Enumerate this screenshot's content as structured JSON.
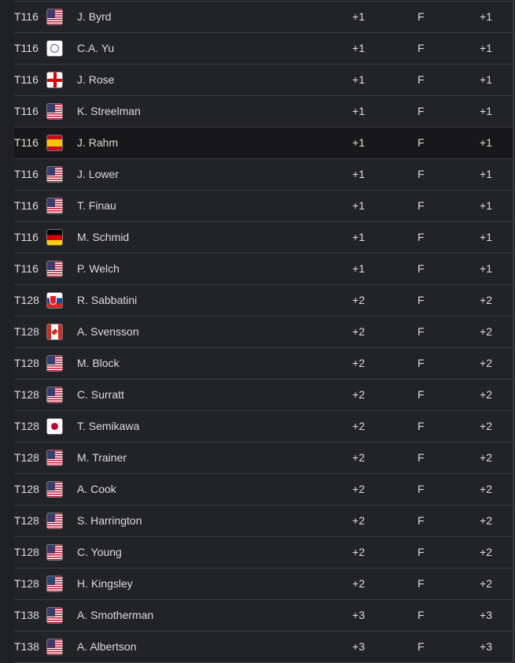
{
  "leaderboard": {
    "highlighted_row": 4,
    "rows": [
      {
        "pos": "T116",
        "flag": "usa",
        "name": "J. Byrd",
        "today": "+1",
        "thru": "F",
        "total": "+1"
      },
      {
        "pos": "T116",
        "flag": "tpe",
        "name": "C.A. Yu",
        "today": "+1",
        "thru": "F",
        "total": "+1"
      },
      {
        "pos": "T116",
        "flag": "eng",
        "name": "J. Rose",
        "today": "+1",
        "thru": "F",
        "total": "+1"
      },
      {
        "pos": "T116",
        "flag": "usa",
        "name": "K. Streelman",
        "today": "+1",
        "thru": "F",
        "total": "+1"
      },
      {
        "pos": "T116",
        "flag": "esp",
        "name": "J. Rahm",
        "today": "+1",
        "thru": "F",
        "total": "+1"
      },
      {
        "pos": "T116",
        "flag": "usa",
        "name": "J. Lower",
        "today": "+1",
        "thru": "F",
        "total": "+1"
      },
      {
        "pos": "T116",
        "flag": "usa",
        "name": "T. Finau",
        "today": "+1",
        "thru": "F",
        "total": "+1"
      },
      {
        "pos": "T116",
        "flag": "ger",
        "name": "M. Schmid",
        "today": "+1",
        "thru": "F",
        "total": "+1"
      },
      {
        "pos": "T116",
        "flag": "usa",
        "name": "P. Welch",
        "today": "+1",
        "thru": "F",
        "total": "+1"
      },
      {
        "pos": "T128",
        "flag": "svk",
        "name": "R. Sabbatini",
        "today": "+2",
        "thru": "F",
        "total": "+2"
      },
      {
        "pos": "T128",
        "flag": "can",
        "name": "A. Svensson",
        "today": "+2",
        "thru": "F",
        "total": "+2"
      },
      {
        "pos": "T128",
        "flag": "usa",
        "name": "M. Block",
        "today": "+2",
        "thru": "F",
        "total": "+2"
      },
      {
        "pos": "T128",
        "flag": "usa",
        "name": "C. Surratt",
        "today": "+2",
        "thru": "F",
        "total": "+2"
      },
      {
        "pos": "T128",
        "flag": "jpn",
        "name": "T. Semikawa",
        "today": "+2",
        "thru": "F",
        "total": "+2"
      },
      {
        "pos": "T128",
        "flag": "usa",
        "name": "M. Trainer",
        "today": "+2",
        "thru": "F",
        "total": "+2"
      },
      {
        "pos": "T128",
        "flag": "usa",
        "name": "A. Cook",
        "today": "+2",
        "thru": "F",
        "total": "+2"
      },
      {
        "pos": "T128",
        "flag": "usa",
        "name": "S. Harrington",
        "today": "+2",
        "thru": "F",
        "total": "+2"
      },
      {
        "pos": "T128",
        "flag": "usa",
        "name": "C. Young",
        "today": "+2",
        "thru": "F",
        "total": "+2"
      },
      {
        "pos": "T128",
        "flag": "usa",
        "name": "H. Kingsley",
        "today": "+2",
        "thru": "F",
        "total": "+2"
      },
      {
        "pos": "T138",
        "flag": "usa",
        "name": "A. Smotherman",
        "today": "+3",
        "thru": "F",
        "total": "+3"
      },
      {
        "pos": "T138",
        "flag": "usa",
        "name": "A. Albertson",
        "today": "+3",
        "thru": "F",
        "total": "+3"
      }
    ]
  }
}
